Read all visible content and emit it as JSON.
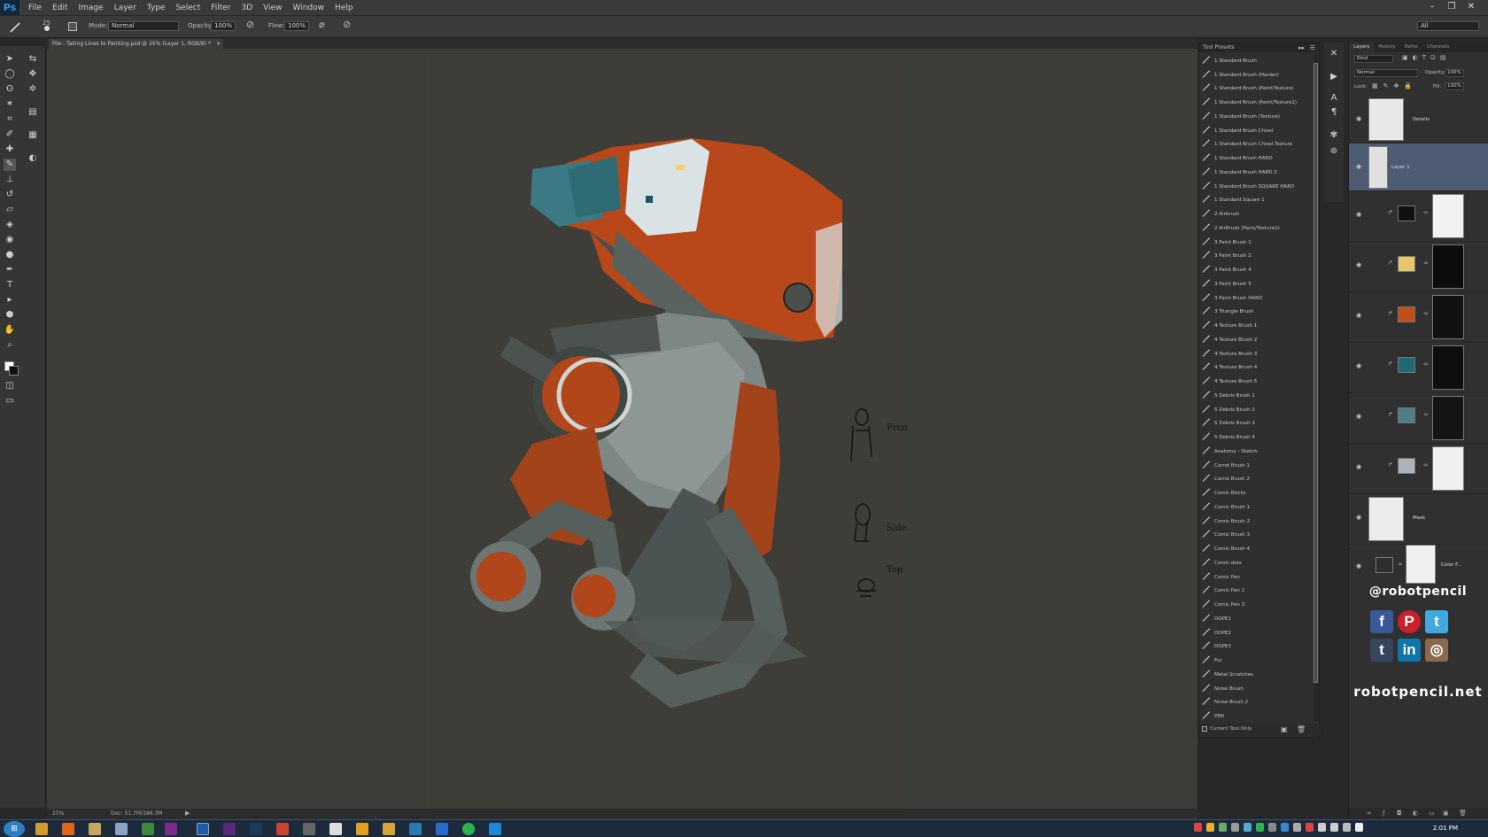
{
  "app": {
    "logo": "Ps"
  },
  "menu": [
    "File",
    "Edit",
    "Image",
    "Layer",
    "Type",
    "Select",
    "Filter",
    "3D",
    "View",
    "Window",
    "Help"
  ],
  "window_controls": {
    "minimize": "–",
    "restore": "❐",
    "close": "✕"
  },
  "options_bar": {
    "mode_label": "Mode:",
    "mode_value": "Normal",
    "opacity_label": "Opacity:",
    "opacity_value": "100%",
    "flow_label": "Flow:",
    "flow_value": "100%",
    "brush_size": "25",
    "workspace_value": "All"
  },
  "document_tab": {
    "title": "File - Taking Lines to Painting.psd @ 25% (Layer 1, RGB/8) *",
    "close": "×"
  },
  "status_bar": {
    "zoom": "25%",
    "doc_size": "Doc: 51.7M/186.3M"
  },
  "tool_presets": {
    "title": "Tool Presets",
    "items": [
      "1 Standard Brush",
      "1 Standard Brush (Harder)",
      "1 Standard Brush (Paint/Texture)",
      "1 Standard Brush (Paint/Texture1)",
      "1 Standard Brush (Texture)",
      "1 Standard Brush Chisel",
      "1 Standard Brush Chisel Texture",
      "1 Standard Brush HARD",
      "1 Standard Brush HARD 2",
      "1 Standard Brush SQUARE HARD",
      "1 Standard Square 1",
      "2 Airbrush",
      "2 AirBrush (Paint/Texture1)",
      "3 Paint Brush 1",
      "3 Paint Brush 2",
      "3 Paint Brush 4",
      "3 Paint Brush 5",
      "3 Paint Brush HARD",
      "3 Triangle Brush",
      "4 Texture Brush 1",
      "4 Texture Brush 2",
      "4 Texture Brush 3",
      "4 Texture Brush 4",
      "4 Texture Brush 5",
      "5 Debris Brush 1",
      "5 Debris Brush 2",
      "5 Debris Brush 3",
      "5 Debris Brush 4",
      "Anatomy - Sketch",
      "Carrot Brush 1",
      "Carrot Brush 2",
      "Comic Bricks",
      "Comic Brush 1",
      "Comic Brush 2",
      "Comic Brush 3",
      "Comic Brush 4",
      "Comic dots",
      "Comic Pen",
      "Comic Pen 2",
      "Comic Pen 3",
      "DOPE1",
      "DOPE2",
      "DOPE3",
      "Fur",
      "Metal Scratches",
      "Noise Brush",
      "Noise Brush 2",
      "PEN"
    ],
    "current_tool_only": "Current Tool Only"
  },
  "layers_panel": {
    "tabs": [
      "Layers",
      "History",
      "Paths",
      "Channels"
    ],
    "kind": "Kind",
    "blend_mode": "Normal",
    "opacity_label": "Opacity:",
    "opacity_value": "100%",
    "lock_label": "Lock:",
    "fill_label": "Fill:",
    "fill_value": "100%",
    "layers": [
      {
        "name": "Details"
      },
      {
        "name": "Layer 1"
      },
      {
        "name": ""
      },
      {
        "name": ""
      },
      {
        "name": ""
      },
      {
        "name": ""
      },
      {
        "name": ""
      },
      {
        "name": ""
      },
      {
        "name": "Mask"
      },
      {
        "name": "Color F..."
      }
    ]
  },
  "swatches": {
    "black": "#111111",
    "yellow": "#e8c56a",
    "orange": "#c24e18",
    "teal": "#1f6a73",
    "blue_gray": "#4f7e86",
    "light_gray": "#a8b4b7"
  },
  "sketch_notes": {
    "front": "Front",
    "side": "Side",
    "top": "Top"
  },
  "watermark": {
    "handle": "@robotpencil",
    "site": "robotpencil.net",
    "socials": [
      "f",
      "P",
      "t",
      "t",
      "in",
      "◎"
    ]
  },
  "taskbar": {
    "clock": "2:01 PM"
  }
}
